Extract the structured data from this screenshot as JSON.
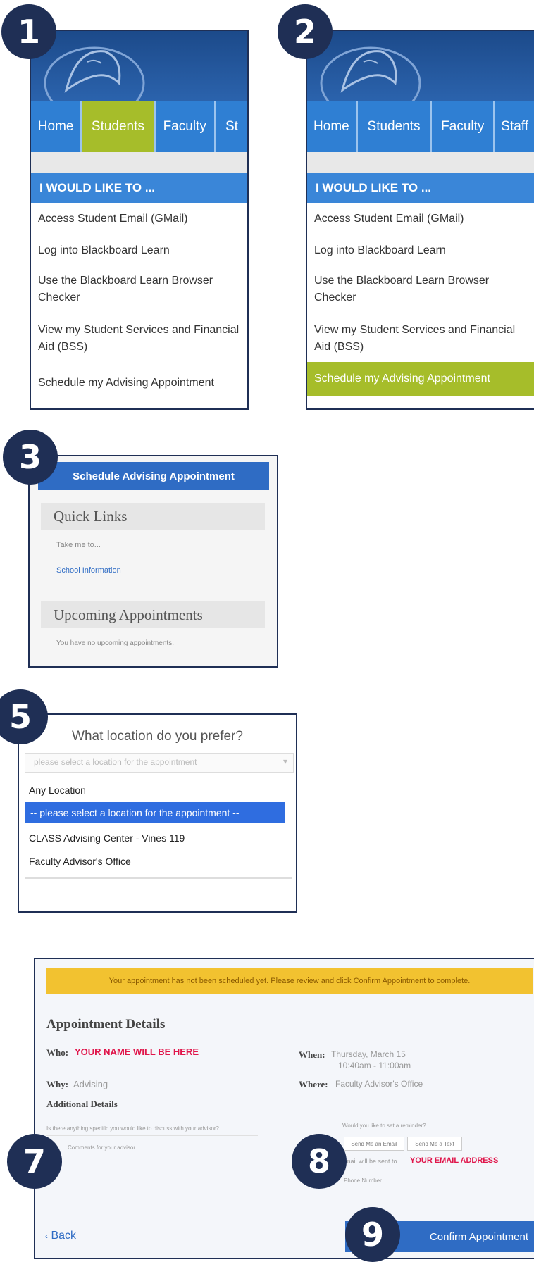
{
  "badges": {
    "b1": "1",
    "b2": "2",
    "b3": "3",
    "b5": "5",
    "b7": "7",
    "b8": "8",
    "b9": "9"
  },
  "panel1": {
    "tabs": [
      "Home",
      "Students",
      "Faculty",
      "St"
    ],
    "menu_title": "I WOULD LIKE TO ...",
    "items": [
      "Access Student Email (GMail)",
      "Log into Blackboard Learn",
      "Use the Blackboard Learn Browser Checker",
      "View my Student Services and Financial Aid (BSS)",
      "Schedule my Advising Appointment"
    ]
  },
  "panel2": {
    "tabs": [
      "Home",
      "Students",
      "Faculty",
      "Staff"
    ],
    "menu_title": "I WOULD LIKE TO ...",
    "items": [
      "Access Student Email (GMail)",
      "Log into Blackboard Learn",
      "Use the Blackboard Learn Browser Checker",
      "View my Student Services and Financial Aid (BSS)",
      "Schedule my Advising Appointment"
    ]
  },
  "panel3": {
    "button": "Schedule Advising Appointment",
    "quick_links": "Quick Links",
    "take_me": "Take me to...",
    "school_info": "School Information",
    "upcoming": "Upcoming Appointments",
    "no_appts": "You have no upcoming appointments."
  },
  "panel5": {
    "question": "What location do you prefer?",
    "select_value": "please select a location for the appointment",
    "options": [
      "Any Location",
      "-- please select a location for the appointment --",
      "CLASS Advising Center - Vines 119",
      "Faculty Advisor's Office"
    ]
  },
  "panel_final": {
    "notice": "Your appointment has not been scheduled yet. Please review and click Confirm Appointment to complete.",
    "title": "Appointment Details",
    "who_label": "Who:",
    "who_value": "YOUR NAME WILL BE HERE",
    "why_label": "Why:",
    "why_value": "Advising",
    "additional": "Additional Details",
    "add_text1": "Is there anything specific you would like to discuss with your advisor?",
    "add_text2": "Comments for your advisor...",
    "when_label": "When:",
    "when_value1": "Thursday, March 15",
    "when_value2": "10:40am - 11:00am",
    "where_label": "Where:",
    "where_value": "Faculty Advisor's Office",
    "reminder_q": "Would you like to set a reminder?",
    "email_btn": "Send Me an Email",
    "text_btn": "Send Me a Text",
    "email_sent": "Email will be sent to",
    "email_value": "YOUR EMAIL ADDRESS",
    "phone": "Phone Number",
    "back": "Back",
    "confirm": "Confirm Appointment"
  }
}
